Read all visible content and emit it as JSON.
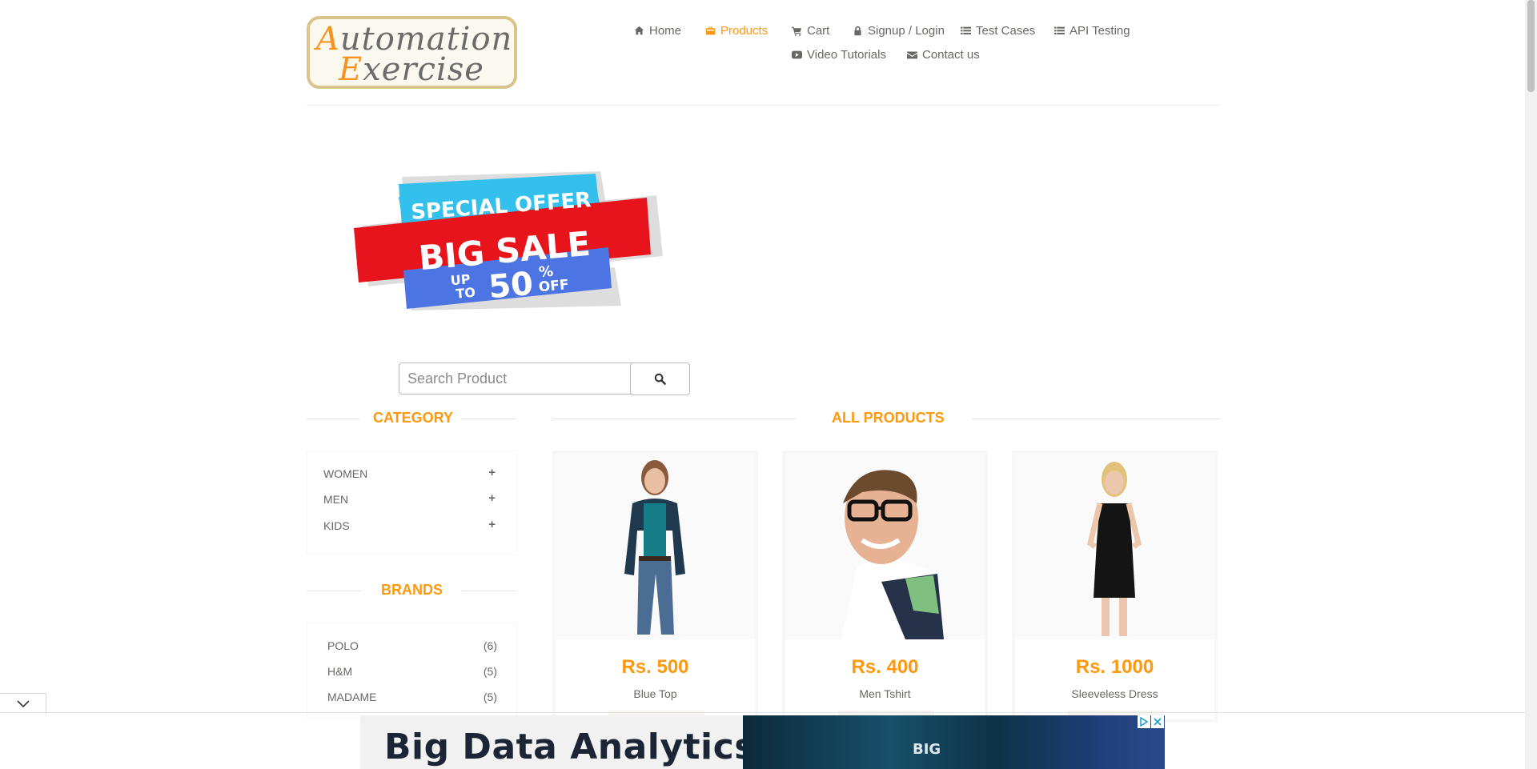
{
  "logo": {
    "line1_cap": "A",
    "line1_rest": "utomation",
    "line2_cap": "E",
    "line2_rest": "xercise"
  },
  "nav": [
    {
      "label": "Home",
      "icon": "home-icon",
      "active": false
    },
    {
      "label": "Products",
      "icon": "product-box-icon",
      "active": true
    },
    {
      "label": "Cart",
      "icon": "cart-icon",
      "active": false
    },
    {
      "label": "Signup / Login",
      "icon": "lock-icon",
      "active": false
    },
    {
      "label": "Test Cases",
      "icon": "list-icon",
      "active": false
    },
    {
      "label": "API Testing",
      "icon": "list-icon",
      "active": false
    },
    {
      "label": "Video Tutorials",
      "icon": "youtube-play-icon",
      "active": false
    },
    {
      "label": "Contact us",
      "icon": "envelope-icon",
      "active": false
    }
  ],
  "banner": {
    "line1": "SPECIAL OFFER",
    "line2": "BIG SALE",
    "line3_up": "UP",
    "line3_to": "TO",
    "line3_pct": "50",
    "line3_sym": "%",
    "line3_off": "OFF"
  },
  "search": {
    "placeholder": "Search Product",
    "value": ""
  },
  "category": {
    "title": "CATEGORY",
    "items": [
      {
        "label": "WOMEN"
      },
      {
        "label": "MEN"
      },
      {
        "label": "KIDS"
      }
    ],
    "expand_symbol": "+"
  },
  "brands": {
    "title": "BRANDS",
    "items": [
      {
        "label": "POLO",
        "count": "(6)"
      },
      {
        "label": "H&M",
        "count": "(5)"
      },
      {
        "label": "MADAME",
        "count": "(5)"
      }
    ]
  },
  "products": {
    "title": "ALL PRODUCTS",
    "items": [
      {
        "price": "Rs. 500",
        "name": "Blue Top"
      },
      {
        "price": "Rs. 400",
        "name": "Men Tshirt"
      },
      {
        "price": "Rs. 1000",
        "name": "Sleeveless Dress"
      }
    ]
  },
  "ad": {
    "headline": "Big Data Analytics",
    "image_text": "BIG"
  },
  "colors": {
    "accent": "#fe980f",
    "text": "#696763",
    "logo_border": "#d9c58c"
  }
}
